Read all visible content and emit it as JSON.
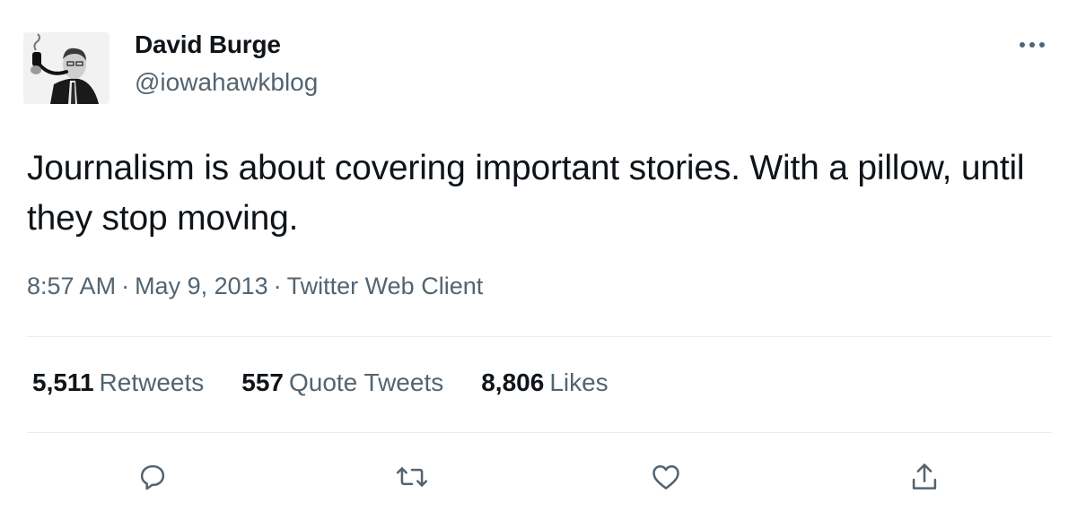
{
  "author": {
    "display_name": "David Burge",
    "handle": "@iowahawkblog",
    "avatar_icon": "profile-photo"
  },
  "tweet": {
    "text": "Journalism is about covering important stories. With a pillow, until they stop moving."
  },
  "meta": {
    "time": "8:57 AM",
    "separator": "·",
    "date": "May 9, 2013",
    "client": "Twitter Web Client"
  },
  "stats": [
    {
      "count": "5,511",
      "label": "Retweets"
    },
    {
      "count": "557",
      "label": "Quote Tweets"
    },
    {
      "count": "8,806",
      "label": "Likes"
    }
  ],
  "actions": {
    "reply_icon": "reply-icon",
    "retweet_icon": "retweet-icon",
    "like_icon": "heart-icon",
    "share_icon": "share-icon",
    "more_icon": "more-icon"
  },
  "colors": {
    "text_primary": "#0f1419",
    "text_secondary": "#536471",
    "divider": "#e6ecf0"
  }
}
